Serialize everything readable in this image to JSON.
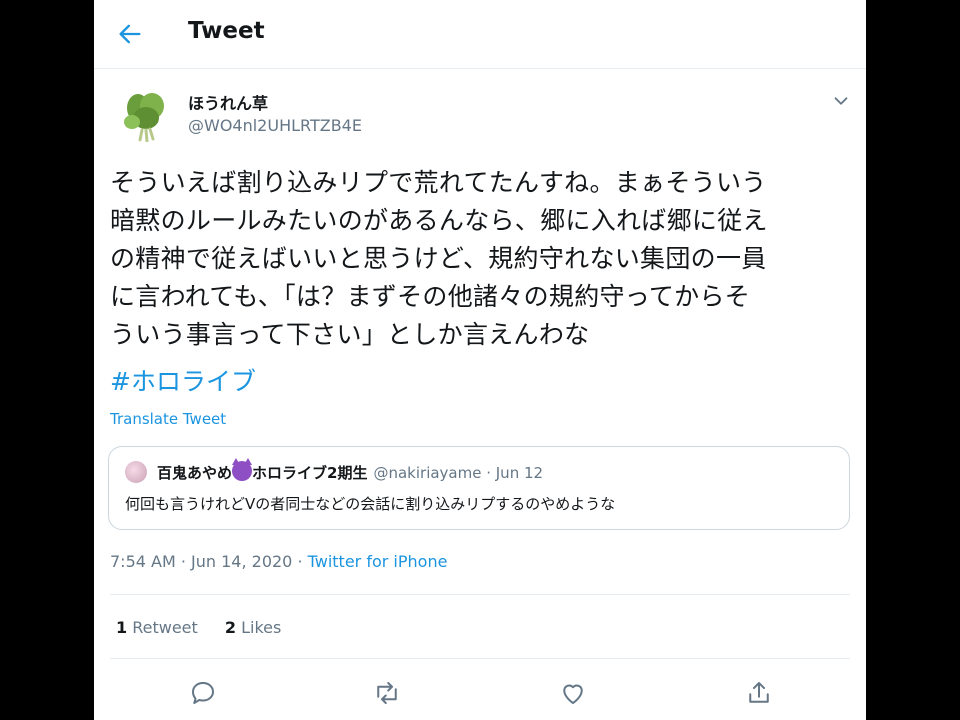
{
  "header": {
    "title": "Tweet"
  },
  "tweet": {
    "author_name": "ほうれん草",
    "author_handle": "@WO4nl2UHLRTZB4E",
    "lines": [
      "そういえば割り込みリプで荒れてたんすね。まぁそういう",
      "暗黙のルールみたいのがあるんなら、郷に入れば郷に従え",
      "の精神で従えばいいと思うけど、規約守れない集団の一員",
      "に言われても、「は？まずその他諸々の規約守ってからそ",
      "ういう事言って下さい」としか言えんわな"
    ],
    "hashtag": "#ホロライブ",
    "translate": "Translate Tweet",
    "time": "7:54 AM · Jun 14, 2020 · ",
    "source": "Twitter for iPhone",
    "retweets": "1",
    "retweets_label": " Retweet",
    "likes": "2",
    "likes_label": " Likes"
  },
  "quote": {
    "name_a": "百鬼あやめ",
    "name_b": "ホロライブ2期生",
    "handle_date": "@nakiriayame · Jun 12",
    "text": "何回も言うけれどVの者同士などの会話に割り込みリプするのやめような"
  },
  "icons": [
    "back-arrow-icon",
    "chevron-down-icon",
    "reply-icon",
    "retweet-icon",
    "like-icon",
    "share-icon"
  ],
  "colors": {
    "accent": "#1b95e0",
    "muted": "#657786",
    "text": "#14171a"
  }
}
